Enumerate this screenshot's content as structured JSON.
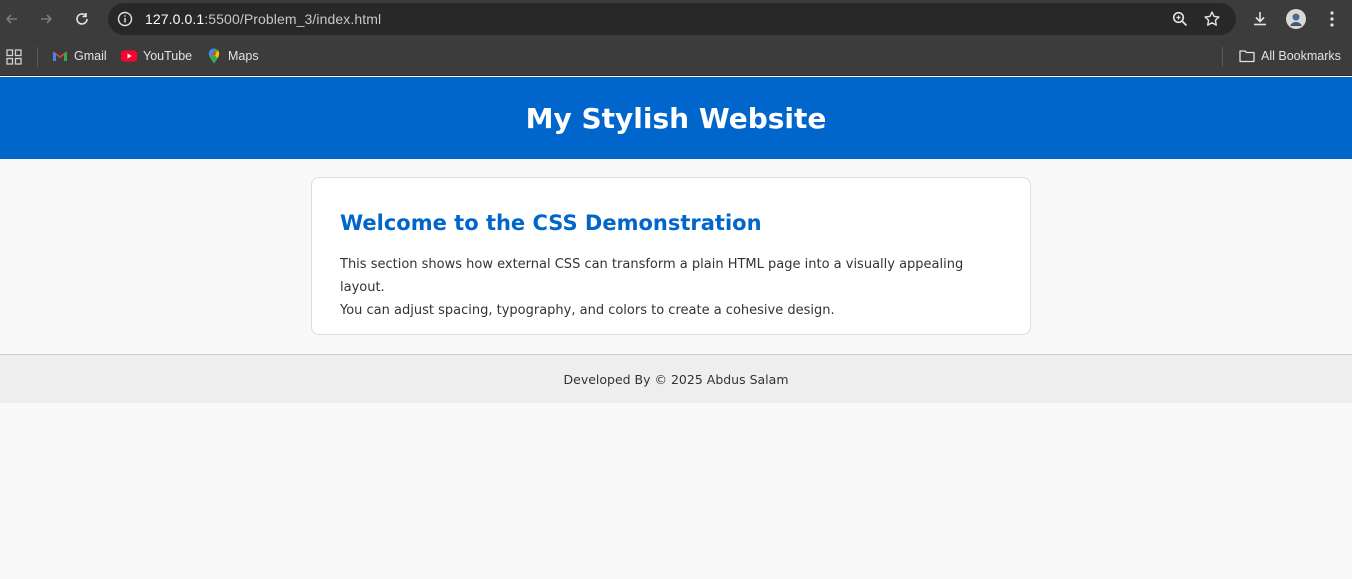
{
  "browser": {
    "url_host": "127.0.0.1",
    "url_path": ":5500/Problem_3/index.html",
    "bookmarks": [
      {
        "label": "Gmail",
        "icon": "gmail-icon"
      },
      {
        "label": "YouTube",
        "icon": "youtube-icon"
      },
      {
        "label": "Maps",
        "icon": "maps-icon"
      }
    ],
    "all_bookmarks": "All Bookmarks"
  },
  "page": {
    "header_title": "My Stylish Website",
    "section_heading": "Welcome to the CSS Demonstration",
    "section_text_line1": "This section shows how external CSS can transform a plain HTML page into a visually appealing layout.",
    "section_text_line2": "You can adjust spacing, typography, and colors to create a cohesive design.",
    "footer_text": "Developed By © 2025 Abdus Salam"
  },
  "colors": {
    "accent": "#0066cc",
    "chrome_bg": "#3c3c3c",
    "page_bg": "#f9f9f9",
    "footer_bg": "#eeeeee"
  }
}
